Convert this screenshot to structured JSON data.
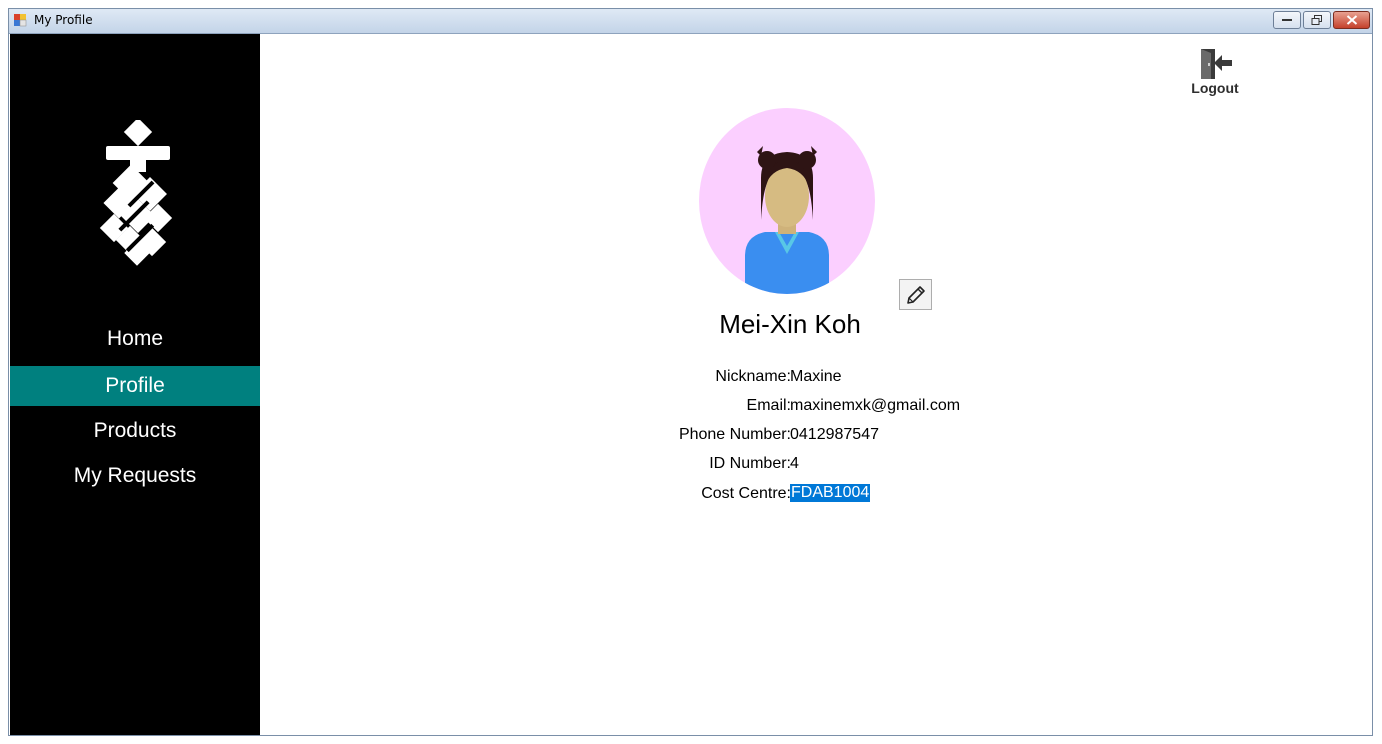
{
  "window": {
    "title": "My Profile"
  },
  "sidebar": {
    "items": [
      {
        "label": "Home",
        "active": false
      },
      {
        "label": "Profile",
        "active": true
      },
      {
        "label": "Products",
        "active": false
      },
      {
        "label": "My Requests",
        "active": false
      }
    ]
  },
  "header": {
    "logout_label": "Logout"
  },
  "profile": {
    "full_name": "Mei-Xin Koh",
    "fields": [
      {
        "label": "Nickname:",
        "value": "Maxine"
      },
      {
        "label": "Email:",
        "value": "maxinemxk@gmail.com"
      },
      {
        "label": "Phone Number:",
        "value": "0412987547"
      },
      {
        "label": "ID Number:",
        "value": "4"
      },
      {
        "label": "Cost Centre:",
        "value": "FDAB1004",
        "selected": true
      }
    ]
  },
  "icons": {
    "app": "app-icon",
    "logo": "company-logo",
    "logout": "logout-door-icon",
    "edit": "pencil-icon",
    "avatar": "user-avatar-illustration"
  },
  "colors": {
    "sidebar_bg": "#000000",
    "active_item_bg": "#00807f",
    "avatar_bg": "#fbcfff",
    "selection_bg": "#0078d7"
  }
}
